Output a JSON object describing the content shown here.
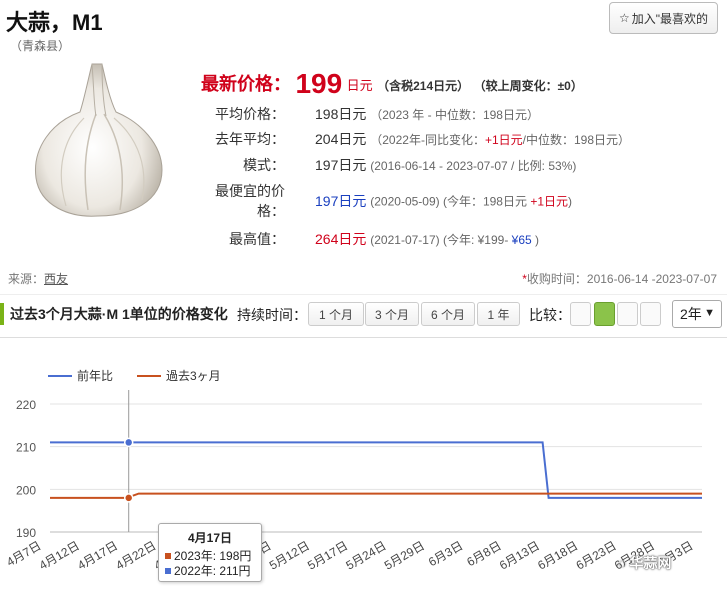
{
  "header": {
    "title": "大蒜，M1",
    "subtitle": "（青森县）",
    "favorite_button": "加入\"最喜欢的"
  },
  "latest": {
    "label": "最新价格：",
    "value": "199",
    "unit": "日元",
    "tax": "（含税214日元）",
    "weekly": "（较上周变化：±0）"
  },
  "stats": {
    "avg": {
      "label": "平均价格：",
      "value": "198日元",
      "note": "（2023 年 - 中位数：198日元）"
    },
    "last_year": {
      "label": "去年平均：",
      "value": "204日元",
      "note_prefix": "（2022年-同比变化：",
      "note_change": "+1日元",
      "note_suffix": "/中位数：198日元）"
    },
    "mode": {
      "label": "模式：",
      "value": "197日元",
      "note": "(2016-06-14 - 2023-07-07 / 比例: 53%)"
    },
    "lowest": {
      "label_line1": "最便宜的价",
      "label_line2": "格：",
      "value": "197日元",
      "note_prefix": "(2020-05-09) (今年：198日元 ",
      "note_change": "+1日元",
      "note_suffix": ")"
    },
    "highest": {
      "label": "最高值：",
      "value": "264日元",
      "note_prefix": "(2021-07-17) (今年: ¥199- ",
      "note_change": "¥65",
      "note_suffix": " )"
    }
  },
  "source": {
    "label": "来源：",
    "link": "西友"
  },
  "period": {
    "star": "*",
    "text": "收购时间：2016-06-14 -2023-07-07"
  },
  "section": {
    "title": "过去3个月大蒜·M 1单位的价格变化",
    "duration_label": "持续时间：",
    "durations": [
      "1 个月",
      "3 个月",
      "6 个月",
      "1 年"
    ],
    "compare_label": "比较：",
    "select_value": "2年"
  },
  "chart_data": {
    "type": "line",
    "legend_placement": "top-left",
    "grid": true,
    "ylim": [
      190,
      222
    ],
    "y_ticks": [
      "220",
      "210",
      "200",
      "190"
    ],
    "x_tick_labels": [
      "4月7日",
      "4月12日",
      "4月17日",
      "4月22日",
      "4月27日",
      "5月2日",
      "5月7日",
      "5月12日",
      "5月17日",
      "5月24日",
      "5月29日",
      "6月3日",
      "6月8日",
      "6月13日",
      "6月18日",
      "6月23日",
      "6月28日",
      "7月3日"
    ],
    "series": [
      {
        "name": "前年比",
        "color": "#4a6ed1",
        "values": [
          211,
          211,
          211,
          211,
          211,
          211,
          211,
          211,
          211,
          211,
          211,
          211,
          211,
          211,
          198,
          198,
          198,
          198
        ]
      },
      {
        "name": "過去3ヶ月",
        "color": "#c8511f",
        "values": [
          198,
          198,
          198,
          199,
          199,
          199,
          199,
          199,
          199,
          199,
          199,
          199,
          199,
          199,
          199,
          199,
          199,
          199
        ]
      }
    ],
    "tooltip": {
      "title": "4月17日",
      "row1": "2023年: 198円",
      "row2": "2022年: 211円"
    }
  },
  "watermark": {
    "text": "华蒜网"
  },
  "colors": {
    "accent_red": "#d0021b",
    "accent_green": "#8bc34a",
    "series_blue": "#4a6ed1",
    "series_orange": "#c8511f"
  }
}
